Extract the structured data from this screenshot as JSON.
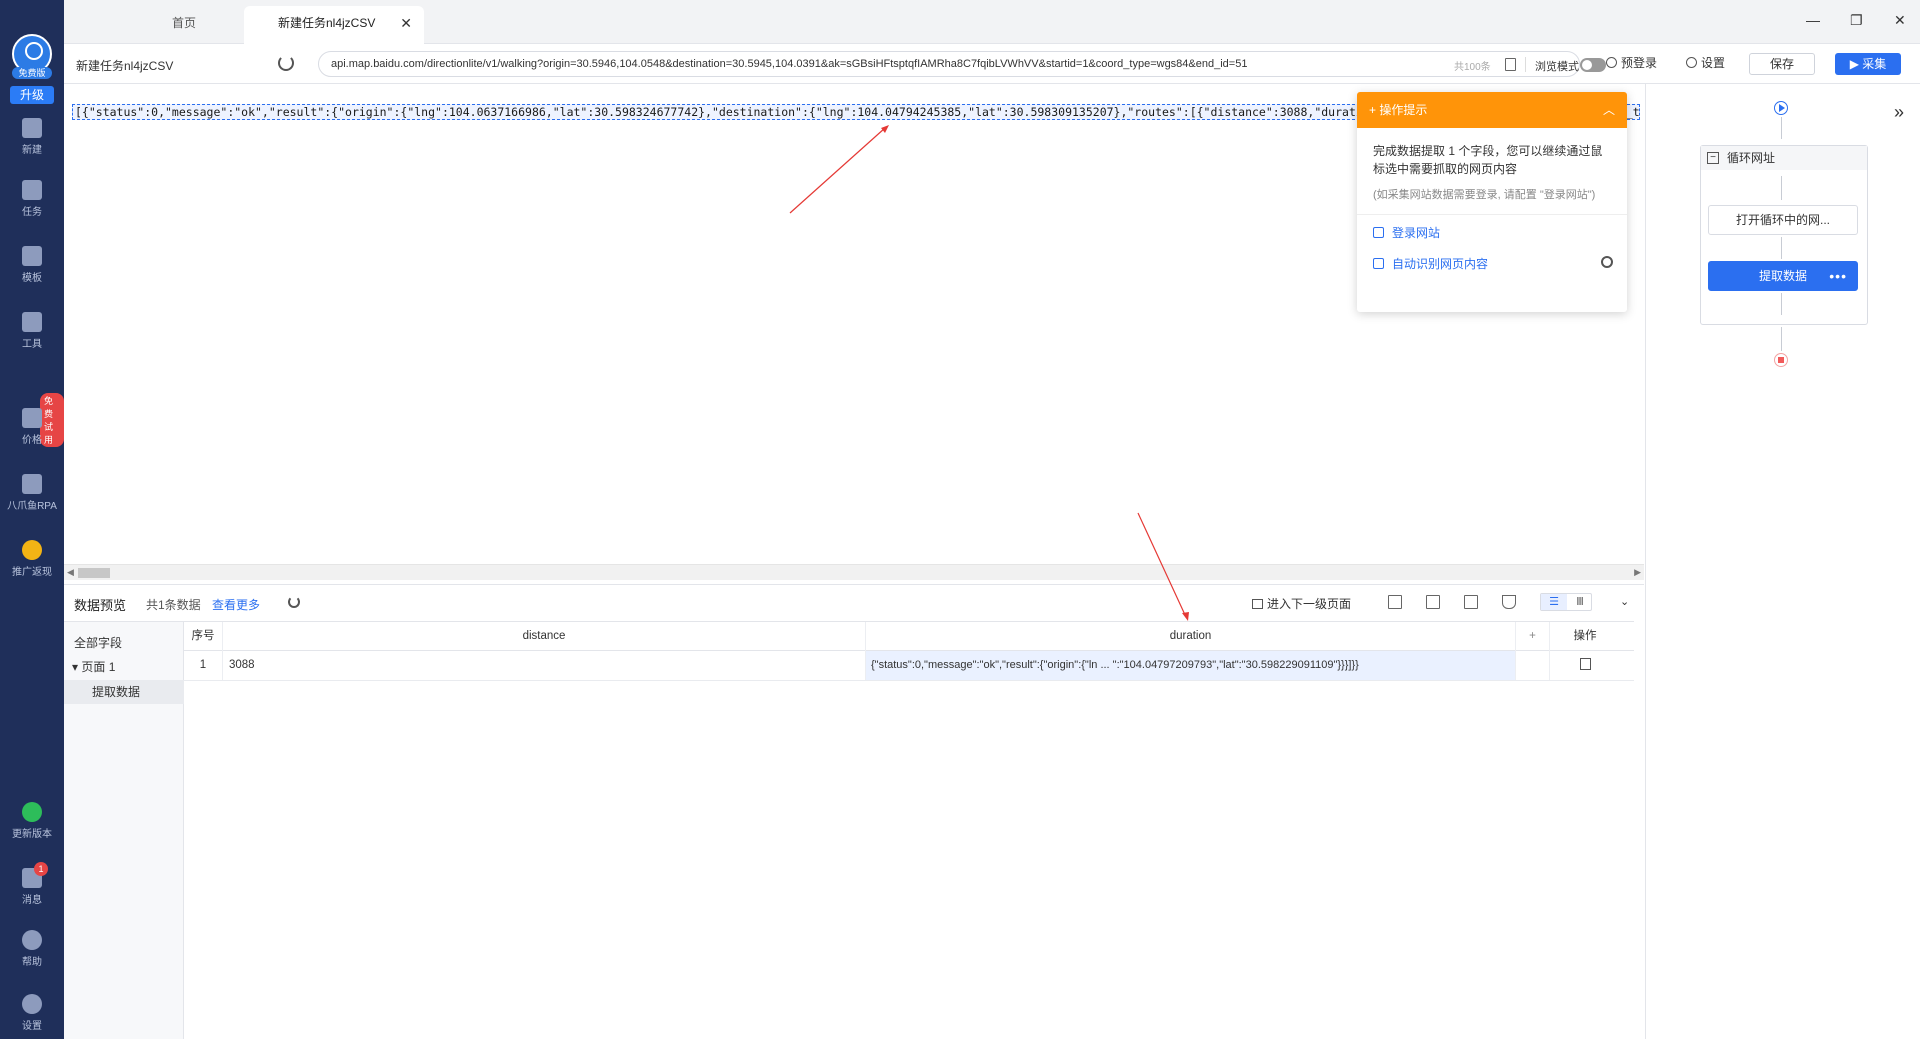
{
  "sidebar": {
    "free_badge": "免费版",
    "upgrade": "升级",
    "items": [
      {
        "label": "新建",
        "icon": "plus-square-icon"
      },
      {
        "label": "任务",
        "icon": "bookmark-icon"
      },
      {
        "label": "模板",
        "icon": "template-icon"
      },
      {
        "label": "工具",
        "icon": "toolbox-icon"
      },
      {
        "label": "价格",
        "icon": "crown-icon"
      },
      {
        "label": "八爪鱼RPA",
        "icon": "octopus-icon"
      },
      {
        "label": "推广返现",
        "icon": "coin-icon"
      },
      {
        "label": "更新版本",
        "icon": "upgrade-arrow-icon"
      },
      {
        "label": "消息",
        "icon": "bell-icon"
      },
      {
        "label": "帮助",
        "icon": "help-icon"
      },
      {
        "label": "设置",
        "icon": "gear-icon"
      }
    ],
    "trial_badge": "免费试用",
    "message_count": "1"
  },
  "tabs": [
    {
      "label": "首页"
    },
    {
      "label": "新建任务nl4jzCSV"
    }
  ],
  "window_controls": {
    "minimize": "—",
    "restore": "❐",
    "close": "✕"
  },
  "addressbar": {
    "task_name": "新建任务nl4jzCSV",
    "url": "api.map.baidu.com/directionlite/v1/walking?origin=30.5946,104.0548&destination=30.5945,104.0391&ak=sGBsiHFtsptqfIAMRha8C7fqibLVWhVV&startid=1&coord_type=wgs84&end_id=51",
    "count": "共100条",
    "browse_mode": "浏览模式",
    "preview_login": "预登录",
    "settings": "设置",
    "save": "保存",
    "collect": "▶ 采集"
  },
  "webview": {
    "json_text": "[{\"status\":0,\"message\":\"ok\",\"result\":{\"origin\":{\"lng\":104.0637166986,\"lat\":30.598324677742},\"destination\":{\"lng\":104.04794245385,\"lat\":30.598309135207},\"routes\":[{\"distance\":3088,\"duration\":2472,\"steps\":[{\"leg_index\":0,\"road_type\":0,\"instruction\":\"..."
  },
  "tip": {
    "title": "操作提示",
    "body": "完成数据提取 1 个字段，您可以继续通过鼠标选中需要抓取的网页内容",
    "note": "(如采集网站数据需要登录, 请配置 \"登录网站\")",
    "link_login": "登录网站",
    "link_auto": "自动识别网页内容"
  },
  "workflow": {
    "loop_label": "循环网址",
    "open_node": "打开循环中的网...",
    "extract_node": "提取数据",
    "more": "•••"
  },
  "preview": {
    "title": "数据预览",
    "count": "共1条数据",
    "view_more": "查看更多",
    "next_level": "进入下一级页面",
    "all_fields": "全部字段",
    "page1": "页面 1",
    "extract": "提取数据",
    "view_list": "☰",
    "view_cols": "Ⅲ",
    "columns": {
      "index": "序号",
      "distance": "distance",
      "duration": "duration",
      "add": "+",
      "op": "操作"
    },
    "rows": [
      {
        "index": "1",
        "distance": "3088",
        "duration": "{\"status\":0,\"message\":\"ok\",\"result\":{\"origin\":{\"ln ... \":\"104.04797209793\",\"lat\":\"30.598229091109\"}}}]}}"
      }
    ]
  },
  "colors": {
    "sidebar": "#1f2f5a",
    "accent": "#2b6ff0",
    "tip_orange": "#ff9409"
  }
}
